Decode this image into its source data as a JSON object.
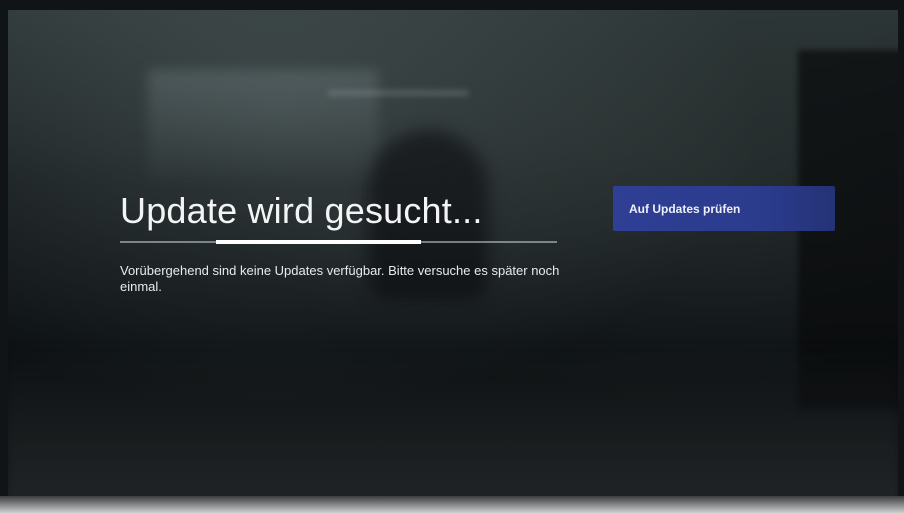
{
  "dialog": {
    "title": "Update wird gesucht...",
    "message": "Vorübergehend sind keine Updates verfügbar. Bitte versuche es später noch einmal.",
    "progress_state": "indeterminate"
  },
  "actions": {
    "check_updates_label": "Auf Updates prüfen"
  },
  "colors": {
    "button_background": "#2e3f95",
    "text": "#f2f4f5",
    "progress": "#ffffff"
  }
}
